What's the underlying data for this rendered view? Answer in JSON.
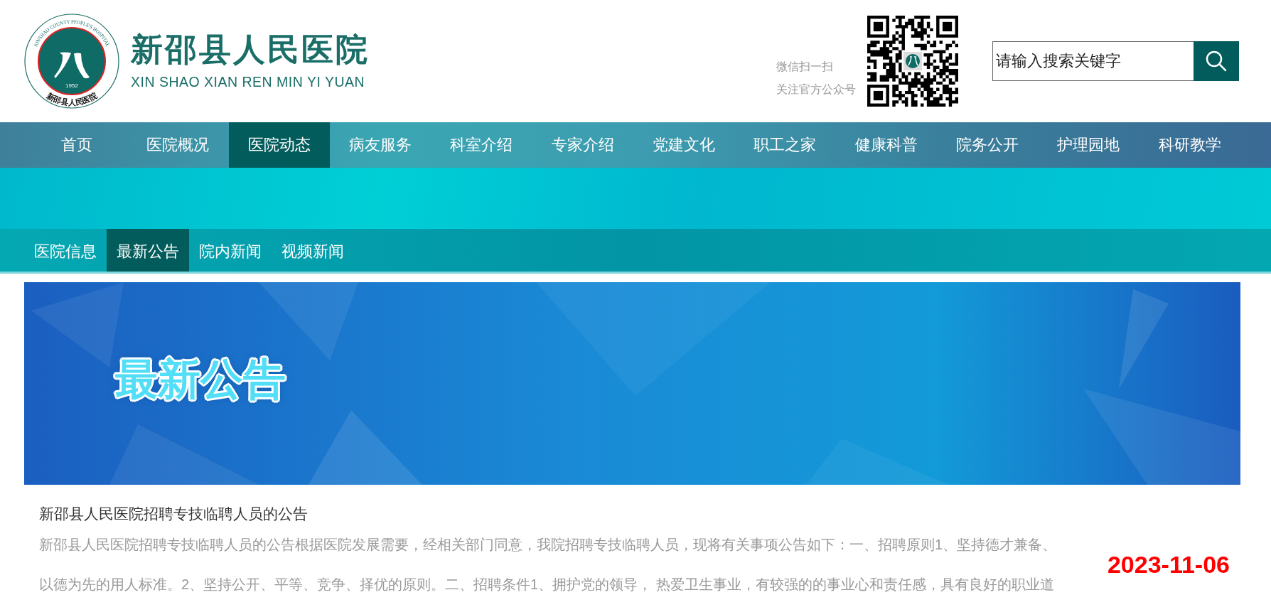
{
  "header": {
    "logo": {
      "ring_text": "XINSHAO COUNTY PEOPLE'S HOSPITAL",
      "year": "1952",
      "bottom_text": "新邵县人民医院"
    },
    "title": "新邵县人民医院",
    "subtitle": "XIN SHAO XIAN REN MIN YI YUAN",
    "qr_caption": [
      "微信扫一扫",
      "关注官方公众号"
    ],
    "search": {
      "placeholder": "请输入搜索关键字"
    }
  },
  "nav": [
    {
      "label": "首页",
      "selected": false
    },
    {
      "label": "医院概况",
      "selected": false
    },
    {
      "label": "医院动态",
      "selected": true
    },
    {
      "label": "病友服务",
      "selected": false
    },
    {
      "label": "科室介绍",
      "selected": false
    },
    {
      "label": "专家介绍",
      "selected": false
    },
    {
      "label": "党建文化",
      "selected": false
    },
    {
      "label": "职工之家",
      "selected": false
    },
    {
      "label": "健康科普",
      "selected": false
    },
    {
      "label": "院务公开",
      "selected": false
    },
    {
      "label": "护理园地",
      "selected": false
    },
    {
      "label": "科研教学",
      "selected": false
    }
  ],
  "subnav": [
    {
      "label": "医院信息",
      "selected": false
    },
    {
      "label": "最新公告",
      "selected": true
    },
    {
      "label": "院内新闻",
      "selected": false
    },
    {
      "label": "视频新闻",
      "selected": false
    }
  ],
  "banner": {
    "title": "最新公告"
  },
  "articles": [
    {
      "title": "新邵县人民医院招聘专技临聘人员的公告",
      "summary": "新邵县人民医院招聘专技临聘人员的公告根据医院发展需要，经相关部门同意，我院招聘专技临聘人员，现将有关事项公告如下：一、招聘原则1、坚持德才兼备、以德为先的用人标准。2、坚持公开、平等、竞争、择优的原则。二、招聘条件1、拥护党的领导， 热爱卫生事业，有较强的的事业心和责任感，具有良好的职业道",
      "date": "2023-11-06"
    }
  ]
}
